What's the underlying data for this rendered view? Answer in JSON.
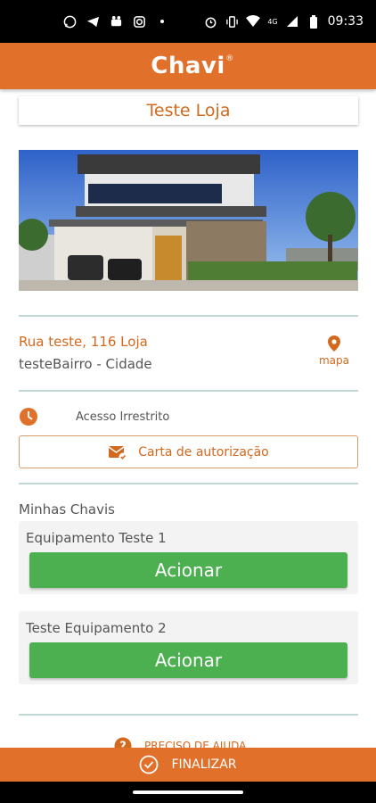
{
  "status_bar": {
    "time": "09:33",
    "network": "4G"
  },
  "app": {
    "logo_text": "Chavi",
    "logo_mark": "®"
  },
  "store": {
    "name": "Teste Loja"
  },
  "address": {
    "street": "Rua teste, 116 Loja",
    "city_line": "testeBairro - Cidade",
    "map_label": "mapa"
  },
  "access": {
    "text": "Acesso Irrestrito",
    "auth_button_label": "Carta de autorização"
  },
  "keys": {
    "title": "Minhas Chavis",
    "items": [
      {
        "name": "Equipamento Teste 1",
        "action_label": "Acionar"
      },
      {
        "name": "Teste Equipamento 2",
        "action_label": "Acionar"
      }
    ]
  },
  "help": {
    "label": "PRECISO DE AJUDA"
  },
  "footer": {
    "finish_label": "FINALIZAR"
  },
  "colors": {
    "brand": "#e0702a",
    "accent_text": "#d2691e",
    "success": "#4caf50",
    "divider": "#bfd8d4"
  }
}
